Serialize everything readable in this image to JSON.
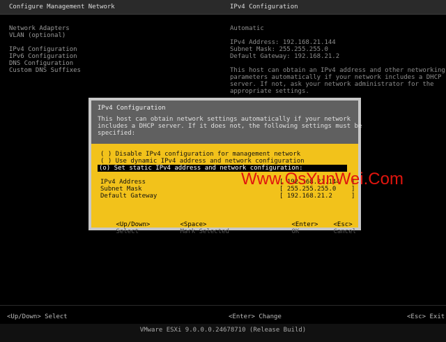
{
  "header": {
    "left_title": "Configure Management Network",
    "right_title": "IPv4 Configuration"
  },
  "menu": {
    "items": [
      "Network Adapters",
      "VLAN (optional)",
      "IPv4 Configuration",
      "IPv6 Configuration",
      "DNS Configuration",
      "Custom DNS Suffixes"
    ]
  },
  "info": {
    "mode": "Automatic",
    "ipv4_address": "IPv4 Address: 192.168.21.144",
    "subnet_mask": "Subnet Mask: 255.255.255.0",
    "default_gateway": "Default Gateway: 192.168.21.2",
    "desc_line1": "This host can obtain an IPv4 address and other networking",
    "desc_line2": "parameters automatically if your network includes a DHCP",
    "desc_line3": "server. If not, ask your network administrator for the",
    "desc_line4": "appropriate settings."
  },
  "dialog": {
    "title": "IPv4 Configuration",
    "desc_line1": "This host can obtain network settings automatically if your network",
    "desc_line2": "includes a DHCP server. If it does not, the following settings must be",
    "desc_line3": "specified:",
    "options": [
      "( ) Disable IPv4 configuration for management network",
      "( ) Use dynamic IPv4 address and network configuration",
      "(o) Set static IPv4 address and network configuration:"
    ],
    "fields": {
      "ipv4_label": "IPv4 Address",
      "ipv4_value": "[ 192.168.21.144   ]",
      "mask_label": "Subnet Mask",
      "mask_value": "[ 255.255.255.0    ]",
      "gw_label": "Default Gateway",
      "gw_value": "[ 192.168.21.2     ]"
    },
    "keys": {
      "updown_key": "<Up/Down>",
      "updown_action": "Select",
      "space_key": "<Space>",
      "space_action": "Mark Selected",
      "enter_key": "<Enter>",
      "enter_action": "OK",
      "esc_key": "<Esc>",
      "esc_action": "Cancel"
    }
  },
  "watermark": "Www.OsYunWei.Com",
  "bottom_bar": {
    "select": "<Up/Down> Select",
    "change": "<Enter> Change",
    "exit": "<Esc> Exit"
  },
  "footer": "VMware ESXi 9.0.0.0.24678710 (Release Build)",
  "colors": {
    "dialog_yellow": "#f2c21b",
    "dialog_gray": "#606060",
    "watermark": "#e0150e"
  }
}
